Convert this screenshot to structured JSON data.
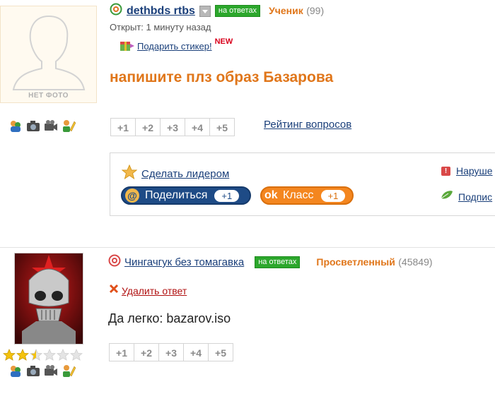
{
  "question": {
    "avatar_label": "НЕТ ФОТО",
    "author": "dethbds rtbs",
    "badge": "на ответах",
    "rank": "Ученик",
    "rank_points": "(99)",
    "opened": "Открыт: 1 минуту назад",
    "gift_sticker": "Подарить стикер!",
    "new_label": "NEW",
    "title": "напишите плз образ Базарова",
    "votes": [
      "+1",
      "+2",
      "+3",
      "+4",
      "+5"
    ],
    "rating_link": "Рейтинг вопросов",
    "make_leader": "Сделать лидером",
    "share_label": "Поделиться",
    "share_count": "+1",
    "class_label": "Класс",
    "class_count": "+1",
    "report_link": "Наруше",
    "subscribe_link": "Подпис"
  },
  "answer": {
    "author": "Чингачгук без томагавка",
    "badge": "на ответах",
    "rank": "Просветленный",
    "rank_points": "(45849)",
    "delete_link": "Удалить ответ",
    "text": "Да легко: bazarov.iso",
    "votes": [
      "+1",
      "+2",
      "+3",
      "+4",
      "+5"
    ],
    "stars_filled": 2.5,
    "stars_total": 6
  },
  "colors": {
    "link": "#1a3f7a",
    "rank_orange": "#e0761a",
    "badge_green": "#2ca72c",
    "share_blue": "#1e4b86",
    "class_orange": "#f4861f"
  }
}
